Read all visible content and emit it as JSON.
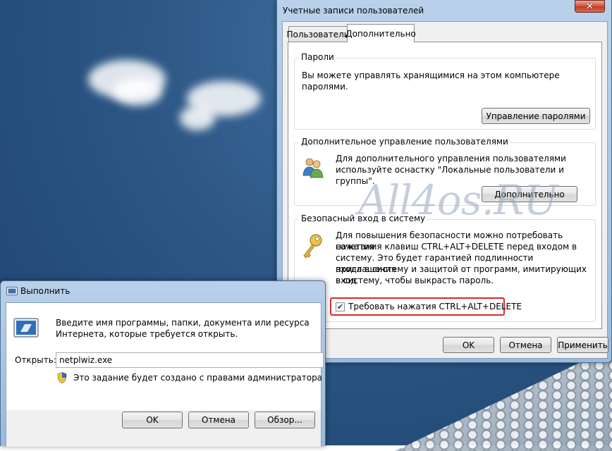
{
  "user_accounts_dialog": {
    "title": "Учетные записи пользователей",
    "tabs": [
      "Пользователи",
      "Дополнительно"
    ],
    "active_tab": "Дополнительно",
    "passwords": {
      "title": "Пароли",
      "text": "Вы можете управлять хранящимися на этом компьютере паролями.",
      "button": "Управление паролями"
    },
    "advanced_users": {
      "title": "Дополнительное управление пользователями",
      "text_line1": "Для дополнительного управления пользователями",
      "text_line2": "используйте оснастку \"Локальные пользователи и группы\".",
      "button": "Дополнительно",
      "icon": "users-icon"
    },
    "secure_logon": {
      "title": "Безопасный вход в систему",
      "text_lines": [
        "Для повышения безопасности можно потребовать нажатия",
        "сочетания клавиш CTRL+ALT+DELETE перед входом в",
        "систему. Это будет гарантией подлинности приглашения",
        "входа в систему и защитой от программ, имитирующих вход",
        "в систему, чтобы выкрасть пароль."
      ],
      "checkbox_label": "Требовать нажатия CTRL+ALT+DELETE",
      "checkbox_checked": true,
      "icon": "key-icon"
    },
    "buttons": {
      "ok": "OK",
      "cancel": "Отмена",
      "apply": "Применить"
    }
  },
  "run_dialog": {
    "title": "Выполнить",
    "description_line1": "Введите имя программы, папки, документа или ресурса",
    "description_line2": "Интернета, которые требуется открыть.",
    "open_label": "Открыть:",
    "input_value": "netplwiz.exe",
    "admin_note": "Это задание будет создано с правами администратора",
    "buttons": {
      "ok": "OK",
      "cancel": "Отмена",
      "browse": "Обзор..."
    }
  },
  "watermark": "All4os.RU",
  "colors": {
    "desktop": "#2c5684",
    "highlight_box": "#d62b2b",
    "window_frame": "#a6c2e0"
  }
}
